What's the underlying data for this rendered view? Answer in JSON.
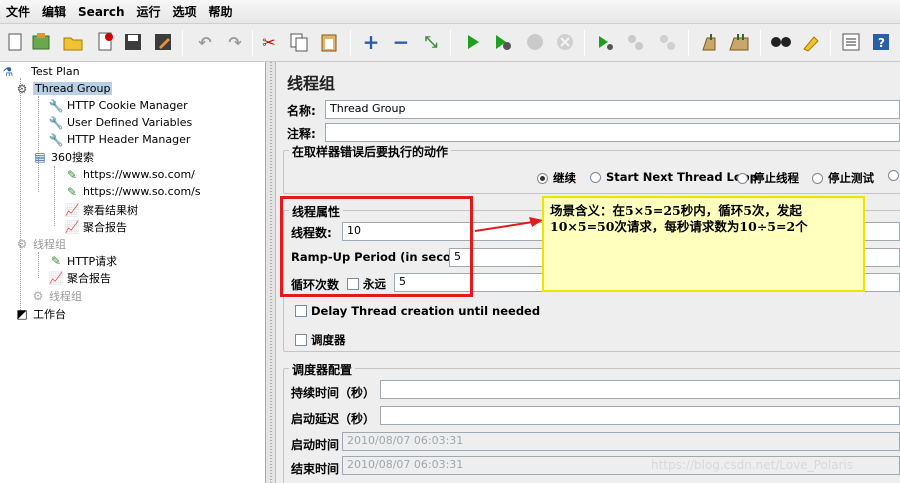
{
  "menu": [
    "文件",
    "编辑",
    "Search",
    "运行",
    "选项",
    "帮助"
  ],
  "toolbar_icons": [
    "new-icon",
    "templates-icon",
    "open-icon",
    "close-file-icon",
    "save-icon",
    "save-as-icon",
    "undo-icon",
    "redo-icon",
    "cut-icon",
    "copy-icon",
    "paste-icon",
    "expand-icon",
    "collapse-icon",
    "toggle-icon",
    "start-icon",
    "start-no-pause-icon",
    "stop-icon",
    "shutdown-icon",
    "remote-start-icon",
    "remote-stop-icon",
    "remote-shutdown-icon",
    "clear-icon",
    "clear-all-icon",
    "search-icon",
    "reset-search-icon",
    "function-helper-icon",
    "help-icon"
  ],
  "tree": {
    "test_plan": "Test Plan",
    "thread_group": "Thread Group",
    "cookie_manager": "HTTP Cookie Manager",
    "user_vars": "User Defined Variables",
    "header_manager": "HTTP Header Manager",
    "controller": "360搜索",
    "sampler1": "https://www.so.com/",
    "sampler2": "https://www.so.com/s",
    "results_tree": "察看结果树",
    "aggregate1": "聚合报告",
    "thread_group2": "线程组",
    "http_request": "HTTP请求",
    "aggregate2": "聚合报告",
    "thread_group3": "线程组",
    "workbench": "工作台"
  },
  "panel": {
    "title": "线程组",
    "name_label": "名称:",
    "name_value": "Thread Group",
    "comment_label": "注释:",
    "comment_value": "",
    "error_legend": "在取样器错误后要执行的动作",
    "actions": [
      "继续",
      "Start Next Thread Loop",
      "停止线程",
      "停止测试"
    ],
    "selected_action": "继续",
    "props_legend": "线程属性",
    "threads_label": "线程数:",
    "threads_value": "10",
    "rampup_label": "Ramp-Up Period (in seconds):",
    "rampup_value": "5",
    "loop_label": "循环次数",
    "forever_label": "永远",
    "loop_value": "5",
    "delay_label": "Delay Thread creation until needed",
    "scheduler_label": "调度器",
    "sched_legend": "调度器配置",
    "duration_label": "持续时间（秒）",
    "delay_start_label": "启动延迟（秒）",
    "start_label": "启动时间",
    "start_value": "2010/08/07 06:03:31",
    "end_label": "结束时间",
    "end_value": "2010/08/07 06:03:31"
  },
  "annotation": {
    "note": "场景含义：在5×5=25秒内，循环5次，发起10×5=50次请求，每秒请求数为10÷5=2个",
    "box_color": "#e31a1a",
    "note_bg": "#ffffbe",
    "note_border": "#efe400"
  },
  "watermark": "https://blog.csdn.net/Love_Polaris"
}
